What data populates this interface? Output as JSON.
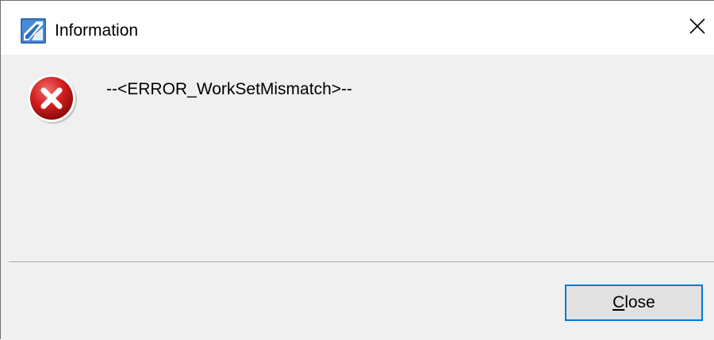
{
  "window": {
    "title": "Information"
  },
  "dialog": {
    "message": "--<ERROR_WorkSetMismatch>--",
    "icon": "error-icon",
    "button": {
      "label_mnemonic": "C",
      "label_rest": "lose"
    }
  },
  "colors": {
    "accent": "#0078d7",
    "error_red": "#d21e1e",
    "background": "#f0f0f0"
  }
}
